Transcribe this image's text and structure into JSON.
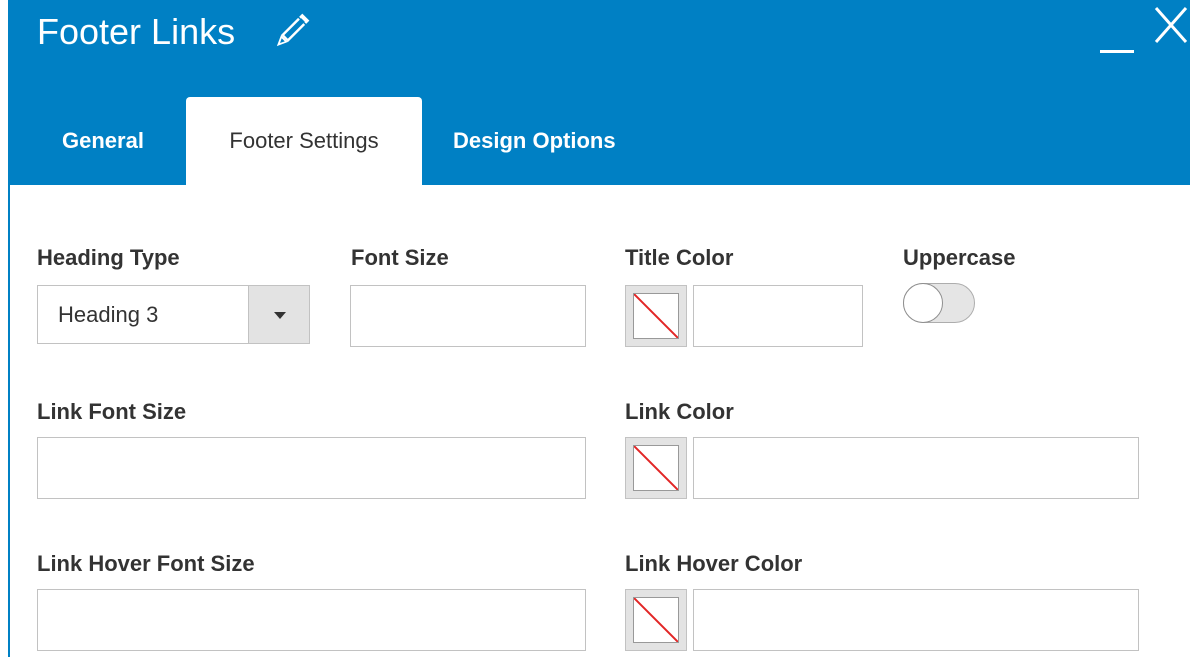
{
  "window": {
    "title": "Footer Links",
    "pencil_icon": "pencil-icon",
    "minimize_icon": "minimize-icon",
    "close_icon": "close-icon"
  },
  "tabs": [
    {
      "label": "General",
      "active": false
    },
    {
      "label": "Footer Settings",
      "active": true
    },
    {
      "label": "Design Options",
      "active": false
    }
  ],
  "form": {
    "heading_type": {
      "label": "Heading Type",
      "value": "Heading 3",
      "arrow_icon": "triangle-down-icon"
    },
    "font_size": {
      "label": "Font Size",
      "value": ""
    },
    "title_color": {
      "label": "Title Color",
      "value": "",
      "swatch_icon": "no-color-swatch-icon"
    },
    "uppercase": {
      "label": "Uppercase",
      "enabled": false
    },
    "link_font_size": {
      "label": "Link Font Size",
      "value": ""
    },
    "link_color": {
      "label": "Link Color",
      "value": "",
      "swatch_icon": "no-color-swatch-icon"
    },
    "link_hover_font_size": {
      "label": "Link Hover Font Size",
      "value": ""
    },
    "link_hover_color": {
      "label": "Link Hover Color",
      "value": "",
      "swatch_icon": "no-color-swatch-icon"
    }
  },
  "colors": {
    "header_blue": "#0080c4",
    "text_dark": "#333333",
    "input_border": "#c2c2c2",
    "swatch_bg": "#e3e3e3",
    "no_color_slash": "#e22626"
  }
}
